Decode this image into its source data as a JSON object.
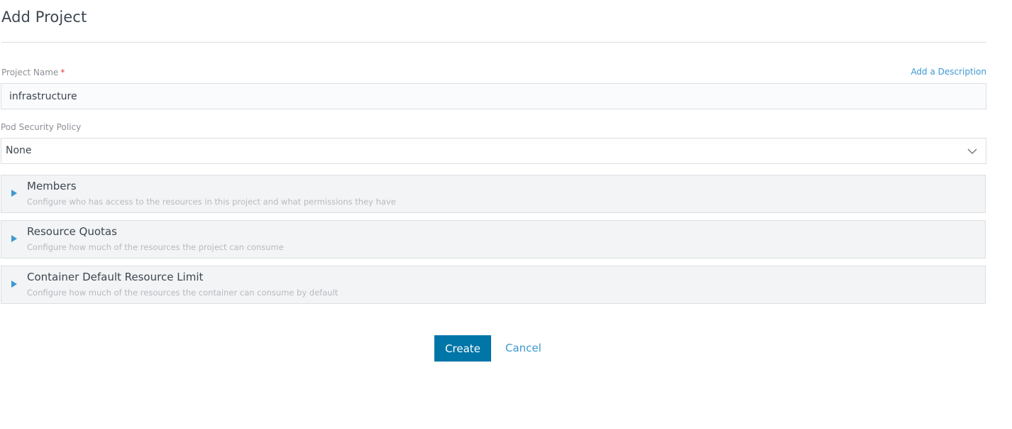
{
  "page": {
    "title": "Add Project"
  },
  "project_name": {
    "label": "Project Name",
    "required_mark": "*",
    "value": "infrastructure",
    "add_description_link": "Add a Description"
  },
  "pod_security_policy": {
    "label": "Pod Security Policy",
    "selected": "None",
    "icon": "chevron-down-icon"
  },
  "sections": [
    {
      "title": "Members",
      "description": "Configure who has access to the resources in this project and what permissions they have",
      "icon": "caret-right-icon"
    },
    {
      "title": "Resource Quotas",
      "description": "Configure how much of the resources the project can consume",
      "icon": "caret-right-icon"
    },
    {
      "title": "Container Default Resource Limit",
      "description": "Configure how much of the resources the container can consume by default",
      "icon": "caret-right-icon"
    }
  ],
  "actions": {
    "create_label": "Create",
    "cancel_label": "Cancel"
  },
  "colors": {
    "primary": "#0075a8",
    "link": "#3d98d3",
    "required": "#e23d3d",
    "section_bg": "#f2f4f5"
  }
}
